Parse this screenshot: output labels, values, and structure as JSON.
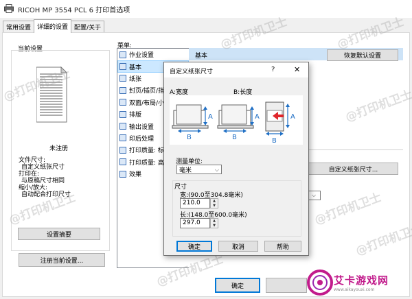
{
  "window": {
    "title": "RICOH MP 3554 PCL 6 打印首选项"
  },
  "tabs": [
    {
      "label": "常用设置"
    },
    {
      "label": "详细的设置"
    },
    {
      "label": "配置/关于"
    }
  ],
  "current_settings": {
    "title": "当前设置",
    "unregistered": "未注册",
    "doc_size_label": "文件尺寸:",
    "doc_size_value": "自定义纸张尺寸",
    "print_on_label": "打印在:",
    "print_on_value": "与原稿尺寸相同",
    "scale_label": "缩小/放大:",
    "scale_value": "自动配合打印尺寸",
    "summary_button": "设置摘要",
    "register_button": "注册当前设置..."
  },
  "menu": {
    "label": "菜单:",
    "items": [
      {
        "label": "作业设置"
      },
      {
        "label": "基本"
      },
      {
        "label": "纸张"
      },
      {
        "label": "封页/插页/指"
      },
      {
        "label": "双面/布局/小"
      },
      {
        "label": "排版"
      },
      {
        "label": "输出设置"
      },
      {
        "label": "印后处理"
      },
      {
        "label": "打印质量: 标"
      },
      {
        "label": "打印质量: 高"
      },
      {
        "label": "效果"
      }
    ]
  },
  "right_panel": {
    "header": "基本",
    "restore_defaults_button": "恢复默认设置",
    "custom_size_button": "自定义纸张尺寸..."
  },
  "footer": {
    "ok_button": "确定"
  },
  "watermark_text": "@打印机卫士",
  "dialog": {
    "title": "自定义纸张尺寸",
    "help_glyph": "?",
    "close_glyph": "✕",
    "width_label": "A:宽度",
    "length_label": "B:长度",
    "unit_label": "测量单位:",
    "unit_value": "毫米",
    "size_group": "尺寸",
    "width_range": "宽:(90.0至304.8毫米)",
    "width_value": "210.0",
    "length_range": "长:(148.0至600.0毫米)",
    "length_value": "297.0",
    "ok": "确定",
    "cancel": "取消",
    "help": "帮助",
    "illus_a": "A",
    "illus_b": "B"
  },
  "badge": {
    "text": "艾卡游戏网",
    "url_text": "www.aikayouxi.com"
  },
  "colors": {
    "selection": "#cce8ff",
    "header_blue": "#cde3f7",
    "arrow_blue": "#1f6fc5",
    "arrow_red": "#e0262b",
    "badge_magenta": "#c21c8c"
  }
}
